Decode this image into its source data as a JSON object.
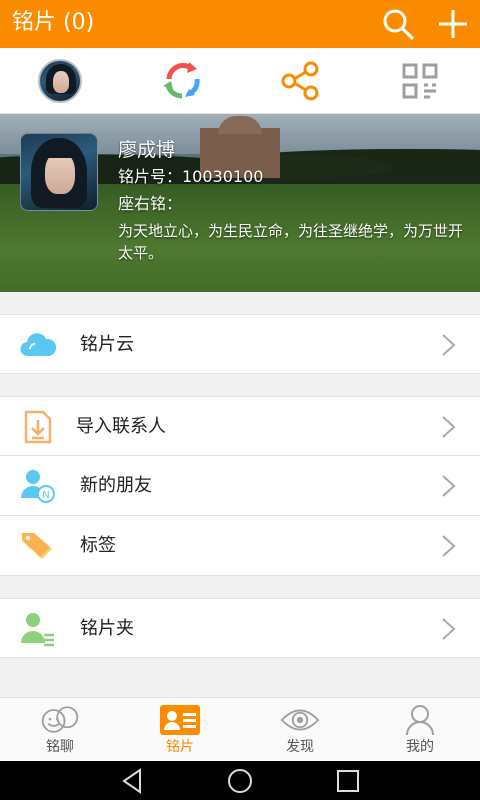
{
  "header": {
    "title": "铭片 (0)",
    "search_icon": "search-icon",
    "add_icon": "plus-icon",
    "bg_color": "#fb8c00"
  },
  "quick_actions": [
    {
      "name": "avatar"
    },
    {
      "name": "sync-icon"
    },
    {
      "name": "share-icon"
    },
    {
      "name": "qr-code-icon"
    }
  ],
  "profile": {
    "name": "廖成博",
    "id_line": "铭片号：10030100",
    "motto_label": "座右铭：",
    "motto": "为天地立心，为生民立命，为往圣继绝学，为万世开太平。"
  },
  "menu": {
    "cloud": "铭片云",
    "import": "导入联系人",
    "new_friends": "新的朋友",
    "tags": "标签",
    "folder": "铭片夹"
  },
  "bottom_nav": {
    "chat": "铭聊",
    "cards": "铭片",
    "discover": "发现",
    "mine": "我的",
    "active": "cards"
  },
  "colors": {
    "accent": "#fb8c00",
    "cloud": "#5ac8f0",
    "green": "#8cd27a"
  }
}
